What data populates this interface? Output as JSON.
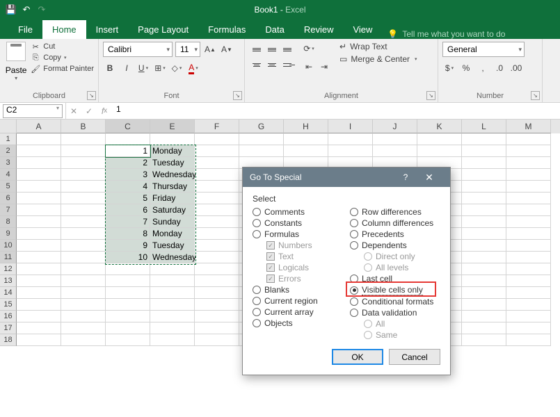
{
  "titlebar": {
    "book": "Book1",
    "app": "Excel"
  },
  "tabs": {
    "file": "File",
    "home": "Home",
    "insert": "Insert",
    "page_layout": "Page Layout",
    "formulas": "Formulas",
    "data": "Data",
    "review": "Review",
    "view": "View",
    "tell_me": "Tell me what you want to do"
  },
  "ribbon": {
    "clipboard": {
      "paste": "Paste",
      "cut": "Cut",
      "copy": "Copy",
      "format_painter": "Format Painter",
      "label": "Clipboard"
    },
    "font": {
      "name": "Calibri",
      "size": "11",
      "label": "Font"
    },
    "alignment": {
      "wrap": "Wrap Text",
      "merge": "Merge & Center",
      "label": "Alignment"
    },
    "number": {
      "format": "General",
      "label": "Number"
    }
  },
  "fbar": {
    "ref": "C2",
    "formula": "1"
  },
  "columns": [
    "A",
    "B",
    "C",
    "E",
    "F",
    "G",
    "H",
    "I",
    "J",
    "K",
    "L",
    "M"
  ],
  "rows_visible": [
    2,
    3,
    4,
    5,
    6,
    7,
    8,
    9,
    10,
    11,
    12,
    13,
    14,
    15,
    16,
    17,
    18
  ],
  "data": {
    "r2": {
      "C": "1",
      "E": "Monday"
    },
    "r3": {
      "C": "2",
      "E": "Tuesday"
    },
    "r4": {
      "C": "3",
      "E": "Wednesday"
    },
    "r5": {
      "C": "4",
      "E": "Thursday"
    },
    "r6": {
      "C": "5",
      "E": "Friday"
    },
    "r7": {
      "C": "6",
      "E": "Saturday"
    },
    "r8": {
      "C": "7",
      "E": "Sunday"
    },
    "r9": {
      "C": "8",
      "E": "Monday"
    },
    "r10": {
      "C": "9",
      "E": "Tuesday"
    },
    "r11": {
      "C": "10",
      "E": "Wednesday"
    }
  },
  "dialog": {
    "title": "Go To Special",
    "section": "Select",
    "left": {
      "comments": "Comments",
      "constants": "Constants",
      "formulas": "Formulas",
      "numbers": "Numbers",
      "text": "Text",
      "logicals": "Logicals",
      "errors": "Errors",
      "blanks": "Blanks",
      "current_region": "Current region",
      "current_array": "Current array",
      "objects": "Objects"
    },
    "right": {
      "row_diff": "Row differences",
      "col_diff": "Column differences",
      "precedents": "Precedents",
      "dependents": "Dependents",
      "direct_only": "Direct only",
      "all_levels": "All levels",
      "last_cell": "Last cell",
      "visible_cells": "Visible cells only",
      "cond_fmt": "Conditional formats",
      "data_val": "Data validation",
      "all": "All",
      "same": "Same"
    },
    "ok": "OK",
    "cancel": "Cancel"
  }
}
